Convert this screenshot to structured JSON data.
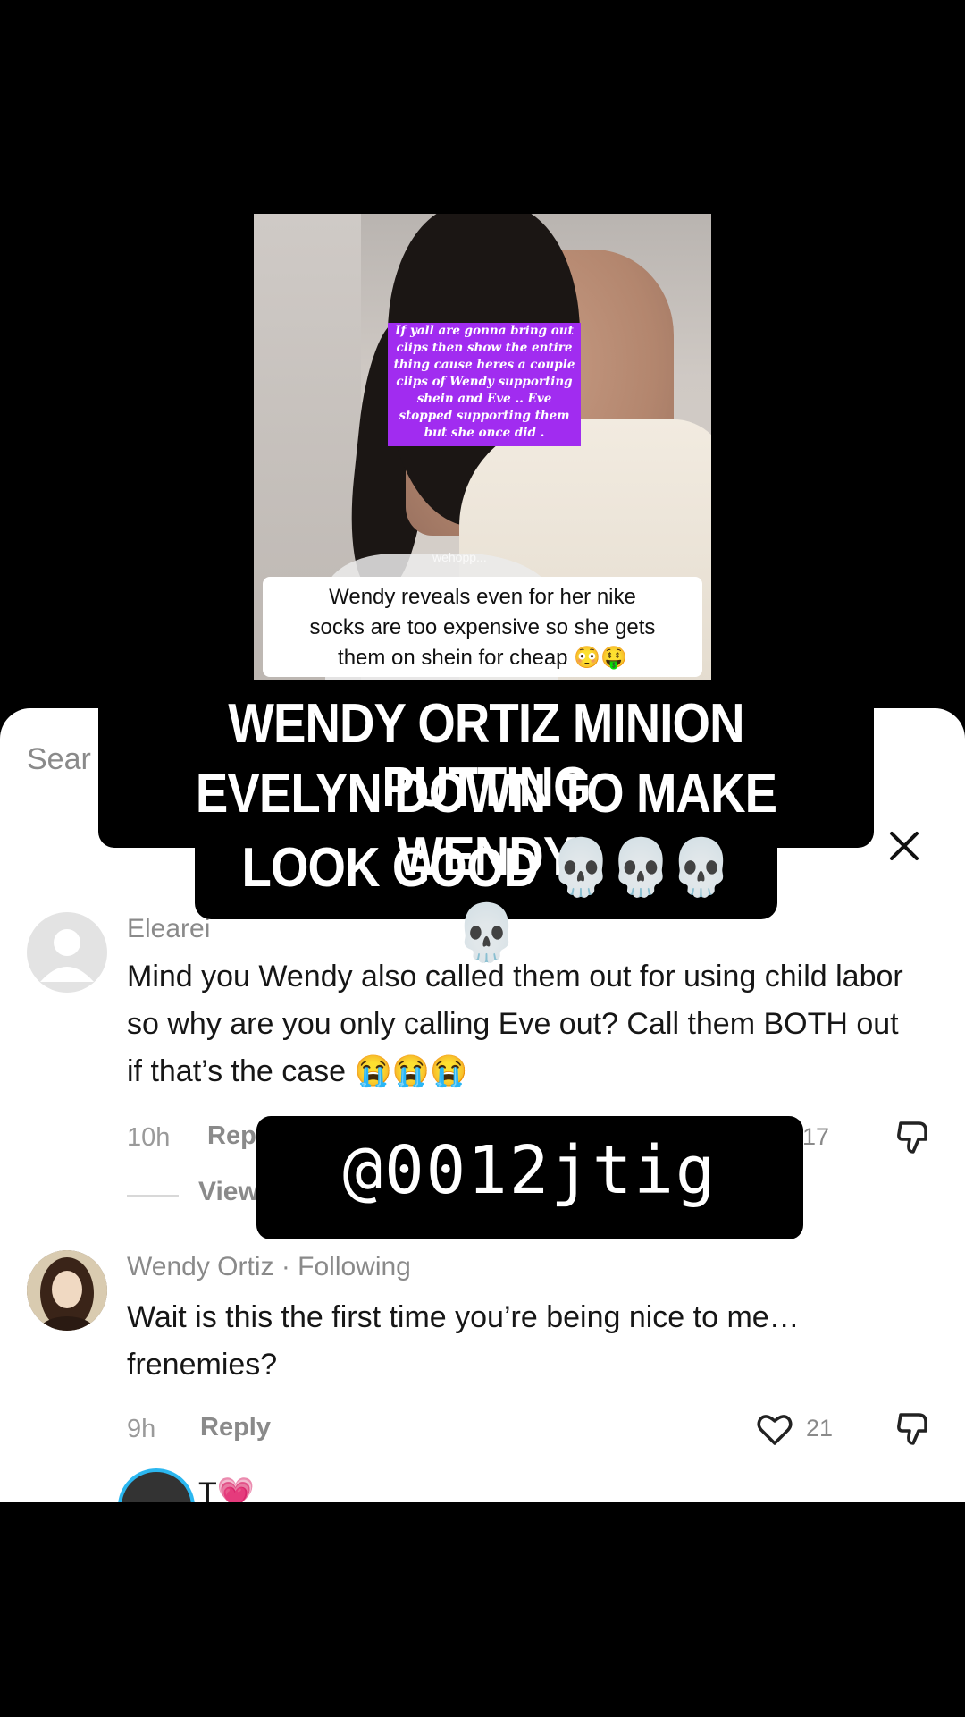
{
  "video": {
    "overlay_text": "If yall are gonna bring out clips then show the entire thing cause heres a couple clips of Wendy supporting shein and Eve .. Eve stopped supporting them but she once did .",
    "watermark": "wehopp...",
    "caption_line1": "Wendy reveals even for her nike",
    "caption_line2": "socks are too expensive so she gets",
    "caption_line3": "them on shein for cheap 😳🤑"
  },
  "title_overlay": {
    "line1": "WENDY ORTIZ MINION PUTTING",
    "line2": "EVELYN DOWN TO MAKE WENDY",
    "line3": "LOOK GOOD 💀💀💀💀"
  },
  "sheet": {
    "search_label": "Sear",
    "close_icon": "close-icon"
  },
  "comments": [
    {
      "username": "Elearei",
      "text": "Mind you Wendy also called them out for using child labor so why are you only calling Eve out? Call them BOTH out if that’s the case 😭😭😭",
      "time": "10h",
      "reply_label": "Rep",
      "like_count": "17",
      "view_label": "View"
    },
    {
      "username": "Wendy Ortiz · Following",
      "text": "Wait is this the first time you’re being nice to me… frenemies?",
      "time": "9h",
      "reply_label": "Reply",
      "like_count": "21"
    },
    {
      "username": "T💗"
    }
  ],
  "handle_overlay": {
    "text": "@0012jtig"
  },
  "colors": {
    "overlay_purple": "#a12cf0",
    "story_ring": "#2bb7f0"
  }
}
